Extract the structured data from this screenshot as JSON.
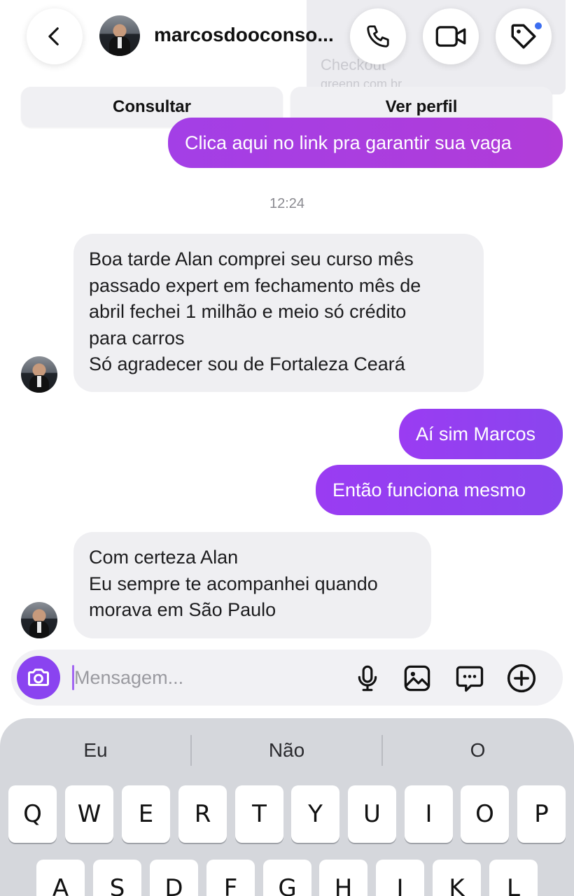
{
  "header": {
    "username": "marcosdooconso...",
    "background_preview": {
      "title": "Checkout",
      "subtitle": "greenn.com.br"
    },
    "notification_dot_color": "#3b6df0"
  },
  "actions": {
    "consultar_label": "Consultar",
    "ver_perfil_label": "Ver perfil"
  },
  "conversation": {
    "link_message": "Clica aqui no link pra garantir sua vaga",
    "timestamp": "12:24",
    "incoming_1": [
      "Boa tarde Alan comprei seu curso mês",
      "passado expert em fechamento mês de",
      "abril fechei 1 milhão e meio só crédito",
      "para carros",
      "Só agradecer sou de Fortaleza Ceará"
    ],
    "outgoing_1": "Aí sim Marcos",
    "outgoing_2": "Então funciona mesmo",
    "incoming_2": [
      "Com certeza Alan",
      "Eu sempre te acompanhei quando",
      "morava em São Paulo"
    ],
    "outgoing_color": "#8a45ee",
    "incoming_color": "#efeff2"
  },
  "composer": {
    "placeholder": "Mensagem...",
    "icons": [
      "camera-icon",
      "microphone-icon",
      "gallery-icon",
      "sticker-icon",
      "plus-icon"
    ],
    "accent_color": "#8a43f0"
  },
  "keyboard": {
    "suggestions": [
      "Eu",
      "Não",
      "O"
    ],
    "row1": [
      "Q",
      "W",
      "E",
      "R",
      "T",
      "Y",
      "U",
      "I",
      "O",
      "P"
    ],
    "row2": [
      "A",
      "S",
      "D",
      "F",
      "G",
      "H",
      "J",
      "K",
      "L"
    ]
  }
}
